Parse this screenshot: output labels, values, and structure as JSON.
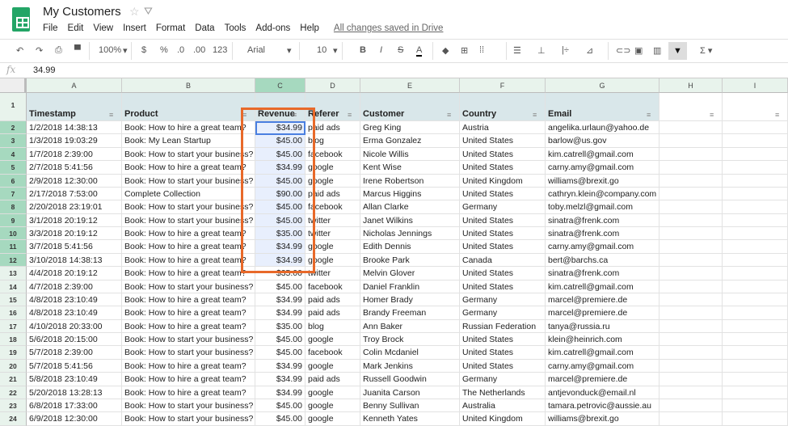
{
  "app": {
    "title": "My Customers",
    "menu": [
      "File",
      "Edit",
      "View",
      "Insert",
      "Format",
      "Data",
      "Tools",
      "Add-ons",
      "Help"
    ],
    "saved_status": "All changes saved in Drive"
  },
  "toolbar": {
    "zoom": "100%",
    "currency": "$",
    "percent": "%",
    "dec_less": ".0",
    "dec_more": ".00",
    "format_more": "123",
    "font": "Arial",
    "font_size": "10"
  },
  "formula_bar": {
    "label": "fx",
    "value": "34.99"
  },
  "columns": [
    "A",
    "B",
    "C",
    "D",
    "E",
    "F",
    "G",
    "H",
    "I"
  ],
  "selected_column": "C",
  "headers": [
    "Timestamp",
    "Product",
    "Revenue",
    "Referer",
    "Customer",
    "Country",
    "Email",
    "",
    ""
  ],
  "rows": [
    [
      "1/2/2018 14:38:13",
      "Book: How to hire a great team?",
      "$34.99",
      "paid ads",
      "Greg King",
      "Austria",
      "angelika.urlaun@yahoo.de"
    ],
    [
      "1/3/2018 19:03:29",
      "Book: My Lean Startup",
      "$45.00",
      "blog",
      "Erma Gonzalez",
      "United States",
      "barlow@us.gov"
    ],
    [
      "1/7/2018 2:39:00",
      "Book: How to start your business?",
      "$45.00",
      "facebook",
      "Nicole Willis",
      "United States",
      "kim.catrell@gmail.com"
    ],
    [
      "2/7/2018 5:41:56",
      "Book: How to hire a great team?",
      "$34.99",
      "google",
      "Kent Wise",
      "United States",
      "carny.amy@gmail.com"
    ],
    [
      "2/9/2018 12:30:00",
      "Book: How to start your business?",
      "$45.00",
      "google",
      "Irene Robertson",
      "United Kingdom",
      "williams@brexit.go"
    ],
    [
      "2/17/2018 7:53:00",
      "Complete Collection",
      "$90.00",
      "paid ads",
      "Marcus Higgins",
      "United States",
      "cathryn.klein@company.com"
    ],
    [
      "2/20/2018 23:19:01",
      "Book: How to start your business?",
      "$45.00",
      "facebook",
      "Allan Clarke",
      "Germany",
      "toby.melzl@gmail.com"
    ],
    [
      "3/1/2018 20:19:12",
      "Book: How to start your business?",
      "$45.00",
      "twitter",
      "Janet Wilkins",
      "United States",
      "sinatra@frenk.com"
    ],
    [
      "3/3/2018 20:19:12",
      "Book: How to hire a great team?",
      "$35.00",
      "twitter",
      "Nicholas Jennings",
      "United States",
      "sinatra@frenk.com"
    ],
    [
      "3/7/2018 5:41:56",
      "Book: How to hire a great team?",
      "$34.99",
      "google",
      "Edith Dennis",
      "United States",
      "carny.amy@gmail.com"
    ],
    [
      "3/10/2018 14:38:13",
      "Book: How to hire a great team?",
      "$34.99",
      "google",
      "Brooke Park",
      "Canada",
      "bert@barchs.ca"
    ],
    [
      "4/4/2018 20:19:12",
      "Book: How to hire a great team?",
      "$35.00",
      "twitter",
      "Melvin Glover",
      "United States",
      "sinatra@frenk.com"
    ],
    [
      "4/7/2018 2:39:00",
      "Book: How to start your business?",
      "$45.00",
      "facebook",
      "Daniel Franklin",
      "United States",
      "kim.catrell@gmail.com"
    ],
    [
      "4/8/2018 23:10:49",
      "Book: How to hire a great team?",
      "$34.99",
      "paid ads",
      "Homer Brady",
      "Germany",
      "marcel@premiere.de"
    ],
    [
      "4/8/2018 23:10:49",
      "Book: How to hire a great team?",
      "$34.99",
      "paid ads",
      "Brandy Freeman",
      "Germany",
      "marcel@premiere.de"
    ],
    [
      "4/10/2018 20:33:00",
      "Book: How to hire a great team?",
      "$35.00",
      "blog",
      "Ann Baker",
      "Russian Federation",
      "tanya@russia.ru"
    ],
    [
      "5/6/2018 20:15:00",
      "Book: How to start your business?",
      "$45.00",
      "google",
      "Troy Brock",
      "United States",
      "klein@heinrich.com"
    ],
    [
      "5/7/2018 2:39:00",
      "Book: How to start your business?",
      "$45.00",
      "facebook",
      "Colin Mcdaniel",
      "United States",
      "kim.catrell@gmail.com"
    ],
    [
      "5/7/2018 5:41:56",
      "Book: How to hire a great team?",
      "$34.99",
      "google",
      "Mark Jenkins",
      "United States",
      "carny.amy@gmail.com"
    ],
    [
      "5/8/2018 23:10:49",
      "Book: How to hire a great team?",
      "$34.99",
      "paid ads",
      "Russell Goodwin",
      "Germany",
      "marcel@premiere.de"
    ],
    [
      "5/20/2018 13:28:13",
      "Book: How to hire a great team?",
      "$34.99",
      "google",
      "Juanita Carson",
      "The Netherlands",
      "antjevonduck@email.nl"
    ],
    [
      "6/8/2018 17:33:00",
      "Book: How to start your business?",
      "$45.00",
      "google",
      "Benny Sullivan",
      "Australia",
      "tamara.petrovic@aussie.au"
    ],
    [
      "6/9/2018 12:30:00",
      "Book: How to start your business?",
      "$45.00",
      "google",
      "Kenneth Yates",
      "United Kingdom",
      "williams@brexit.go"
    ]
  ],
  "colors": {
    "highlight_box": "#e8692a",
    "selection": "#4a7fe0",
    "header_fill": "#d9e7ea"
  }
}
